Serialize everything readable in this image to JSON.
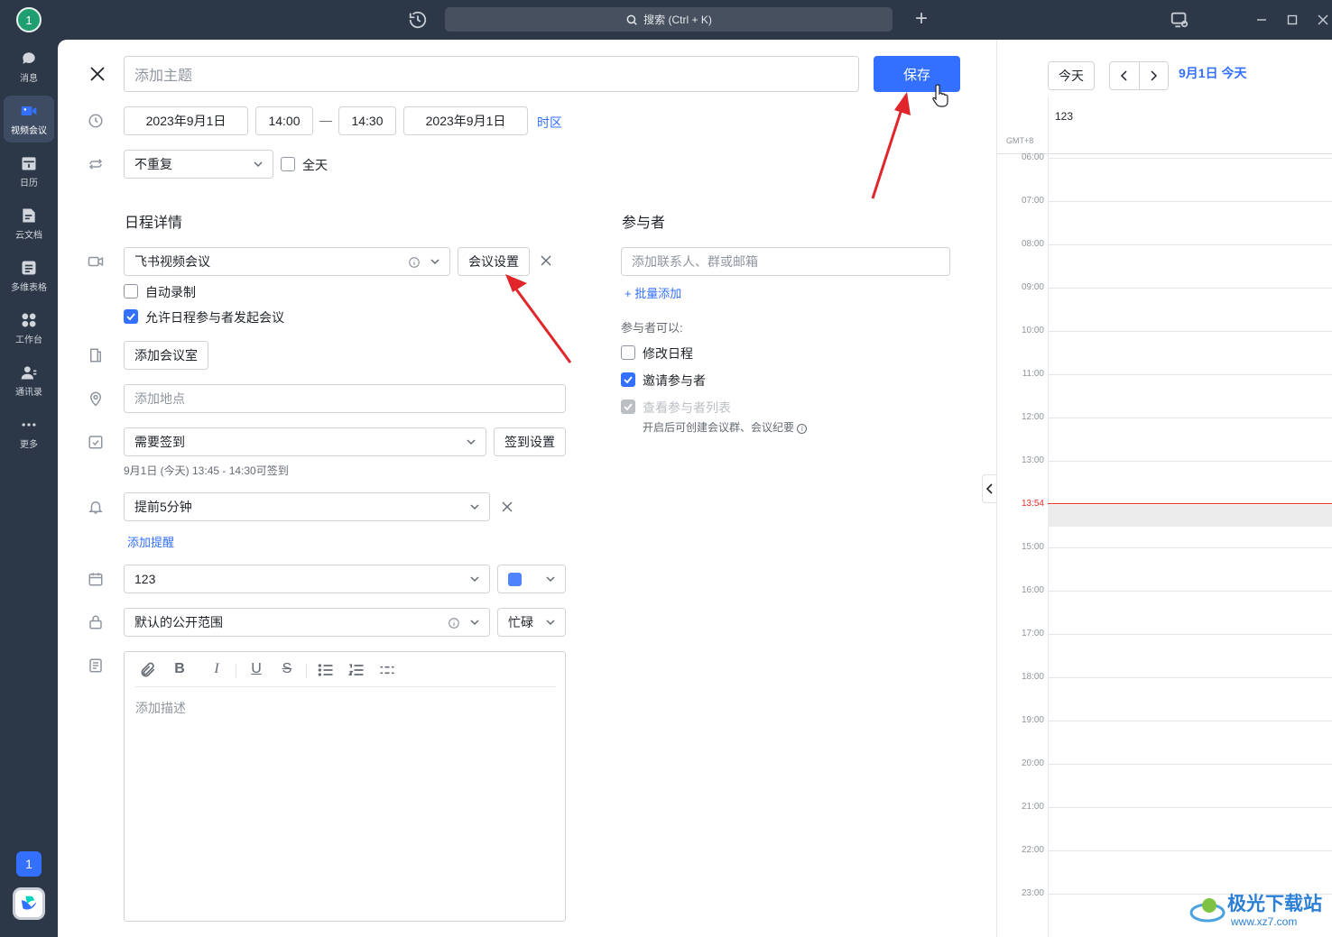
{
  "topbar": {
    "avatar": "1",
    "search_label": "搜索 (Ctrl + K)",
    "plus": "+"
  },
  "rail": {
    "items": [
      {
        "label": "消息",
        "icon": "chat-icon"
      },
      {
        "label": "视频会议",
        "icon": "video-icon"
      },
      {
        "label": "日历",
        "icon": "calendar-icon"
      },
      {
        "label": "云文档",
        "icon": "doc-icon"
      },
      {
        "label": "多维表格",
        "icon": "table-icon"
      },
      {
        "label": "工作台",
        "icon": "apps-icon"
      },
      {
        "label": "通讯录",
        "icon": "contacts-icon"
      },
      {
        "label": "更多",
        "icon": "more-icon"
      }
    ],
    "badge": "1"
  },
  "form": {
    "title_placeholder": "添加主题",
    "save_label": "保存",
    "start_date": "2023年9月1日",
    "start_time": "14:00",
    "dash": "—",
    "end_time": "14:30",
    "end_date": "2023年9月1日",
    "timezone_link": "时区",
    "repeat_value": "不重复",
    "allday_label": "全天",
    "details_heading": "日程详情",
    "meeting_type": "飞书视频会议",
    "meeting_settings": "会议设置",
    "auto_record": "自动录制",
    "allow_start": "允许日程参与者发起会议",
    "add_room": "添加会议室",
    "location_placeholder": "添加地点",
    "checkin_value": "需要签到",
    "checkin_settings": "签到设置",
    "checkin_note": "9月1日 (今天) 13:45 - 14:30可签到",
    "reminder_value": "提前5分钟",
    "add_reminder": "添加提醒",
    "calendar_value": "123",
    "calendar_color": "#4e83fd",
    "visibility_value": "默认的公开范围",
    "busy_value": "忙碌",
    "desc_placeholder": "添加描述",
    "attendees_heading": "参与者",
    "attendee_placeholder": "添加联系人、群或邮箱",
    "bulk_add": "批量添加",
    "attendees_can": "参与者可以:",
    "perm_modify": "修改日程",
    "perm_invite": "邀请参与者",
    "perm_view": "查看参与者列表",
    "perm_note": "开启后可创建会议群、会议纪要"
  },
  "calendar": {
    "today_btn": "今天",
    "date_title": "9月1日 今天",
    "column_name": "123",
    "tz": "GMT+8",
    "hours": [
      "06:00",
      "07:00",
      "08:00",
      "09:00",
      "10:00",
      "11:00",
      "12:00",
      "13:00",
      "13:54",
      "15:00",
      "16:00",
      "17:00",
      "18:00",
      "19:00",
      "20:00",
      "21:00",
      "22:00",
      "23:00"
    ],
    "now_color": "#e22e28"
  },
  "watermark": {
    "text": "极光下载站",
    "url": "www.xz7.com"
  }
}
